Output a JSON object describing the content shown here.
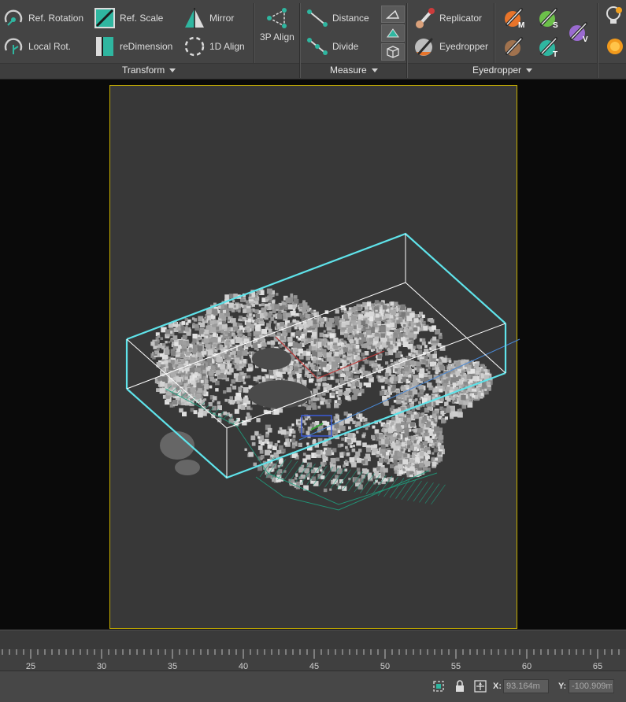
{
  "ribbon": {
    "transform": {
      "ref_rotation": "Ref. Rotation",
      "local_rot": "Local Rot.",
      "ref_scale": "Ref. Scale",
      "redimension": "reDimension",
      "mirror": "Mirror",
      "align_1d": "1D Align",
      "align_3p": "3P Align",
      "group_label": "Transform"
    },
    "measure": {
      "distance": "Distance",
      "divide": "Divide",
      "group_label": "Measure"
    },
    "eyedropper": {
      "replicator": "Replicator",
      "eyedropper": "Eyedropper",
      "group_label": "Eyedropper",
      "tool_letters": [
        "M",
        "S",
        "V",
        "T"
      ]
    },
    "colors": {
      "accent_teal": "#2fb6a0",
      "swatch_orange": "#e8742a",
      "swatch_green": "#6cc04a",
      "swatch_purple": "#9a6bd0"
    }
  },
  "viewport": {
    "selection_color": "#5fe3ea",
    "frame_color": "#c8b000"
  },
  "timeline": {
    "ticks": [
      "25",
      "30",
      "35",
      "40",
      "45",
      "50",
      "55",
      "60",
      "65"
    ]
  },
  "status": {
    "x_label": "X:",
    "x_value": "93.164m",
    "y_label": "Y:",
    "y_value": "-100.909m"
  }
}
